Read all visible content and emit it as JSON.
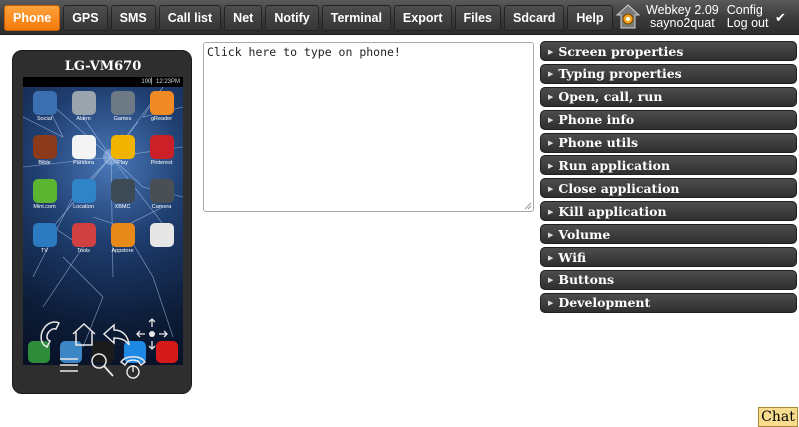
{
  "nav": {
    "tabs": [
      {
        "label": "Phone",
        "active": true
      },
      {
        "label": "GPS"
      },
      {
        "label": "SMS"
      },
      {
        "label": "Call list"
      },
      {
        "label": "Net"
      },
      {
        "label": "Notify"
      },
      {
        "label": "Terminal"
      },
      {
        "label": "Export"
      },
      {
        "label": "Files"
      },
      {
        "label": "Sdcard"
      },
      {
        "label": "Help"
      }
    ],
    "app_version": "Webkey 2.09",
    "username": "sayno2quat",
    "config_label": "Config",
    "logout_label": "Log out",
    "check_glyph": "✔"
  },
  "phone": {
    "model": "LG-VM670",
    "status_time": "100▏12:23PM",
    "apps": [
      {
        "label": "Social",
        "icon": "social-icon",
        "color": "#3b6fb0"
      },
      {
        "label": "Alarm",
        "icon": "alarm-icon",
        "color": "#9aa4ad"
      },
      {
        "label": "Games",
        "icon": "games-icon",
        "color": "#6d7a86"
      },
      {
        "label": "gReader",
        "icon": "rss-icon",
        "color": "#f08a24"
      },
      {
        "label": "Bible",
        "icon": "bible-icon",
        "color": "#8b3a1c"
      },
      {
        "label": "Pandora",
        "icon": "pandora-icon",
        "color": "#f4f4f4"
      },
      {
        "label": "Play",
        "icon": "headphones-icon",
        "color": "#f0b400"
      },
      {
        "label": "Pinterest",
        "icon": "pinterest-icon",
        "color": "#cb2027"
      },
      {
        "label": "Mint.com",
        "icon": "leaf-icon",
        "color": "#5cb531"
      },
      {
        "label": "Location",
        "icon": "globe-icon",
        "color": "#2f84c8"
      },
      {
        "label": "XBMC",
        "icon": "xbmc-icon",
        "color": "#3d4a55"
      },
      {
        "label": "Camera",
        "icon": "camera-icon",
        "color": "#4a4f55"
      },
      {
        "label": "TV",
        "icon": "tv-icon",
        "color": "#2c7bc0"
      },
      {
        "label": "Tools",
        "icon": "tools-icon",
        "color": "#d04040"
      },
      {
        "label": "Appstore",
        "icon": "amazon-icon",
        "color": "#e88a1a"
      },
      {
        "label": "",
        "icon": "play-store-icon",
        "color": "#e6e6e6"
      }
    ],
    "dock": [
      {
        "icon": "phone-dock-icon",
        "color": "#2e8b3a"
      },
      {
        "icon": "messaging-icon",
        "color": "#3d86c6"
      },
      {
        "icon": "app-drawer-icon",
        "color": "#1b1b1b"
      },
      {
        "icon": "dialer-icon",
        "color": "#1e88e5"
      },
      {
        "icon": "opera-icon",
        "color": "#d61a1a"
      }
    ]
  },
  "typing": {
    "placeholder": "Click here to type on phone!"
  },
  "panel": {
    "sections": [
      "Screen properties",
      "Typing properties",
      "Open, call, run",
      "Phone info",
      "Phone utils",
      "Run application",
      "Close application",
      "Kill application",
      "Volume",
      "Wifi",
      "Buttons",
      "Development"
    ],
    "arrow": "▶"
  },
  "chat": {
    "label": "Chat"
  },
  "colors": {
    "accent": "#f47a0c",
    "toolbar": "#3a3a3a",
    "panel_header": "#2f2f2f",
    "chat_bg": "#f8dc8e"
  }
}
